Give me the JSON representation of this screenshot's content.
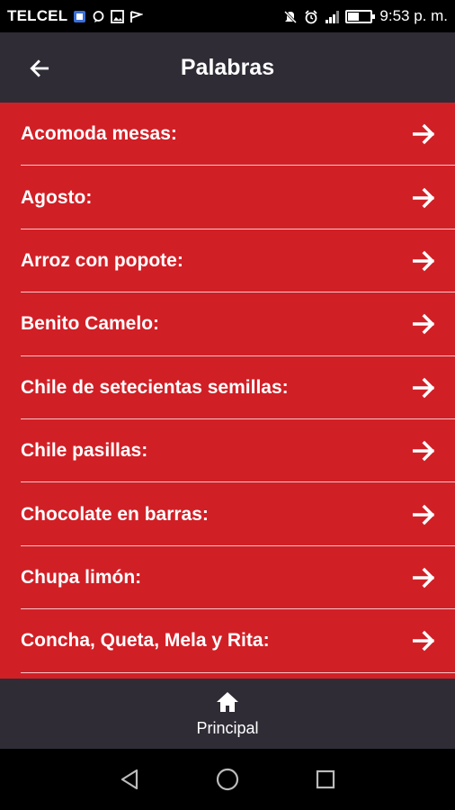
{
  "status_bar": {
    "carrier": "TELCEL",
    "time": "9:53 p. m.",
    "battery_level": 0.45
  },
  "app_bar": {
    "title": "Palabras"
  },
  "list": {
    "items": [
      {
        "label": "Acomoda mesas:"
      },
      {
        "label": "Agosto:"
      },
      {
        "label": "Arroz con popote:"
      },
      {
        "label": "Benito Camelo:"
      },
      {
        "label": "Chile de setecientas semillas:"
      },
      {
        "label": "Chile pasillas:"
      },
      {
        "label": "Chocolate en barras:"
      },
      {
        "label": "Chupa limón:"
      },
      {
        "label": "Concha, Queta, Mela y Rita:"
      }
    ]
  },
  "bottom_nav": {
    "home_label": "Principal"
  },
  "colors": {
    "list_background": "#d11f26",
    "bars": "#2f2c36"
  }
}
